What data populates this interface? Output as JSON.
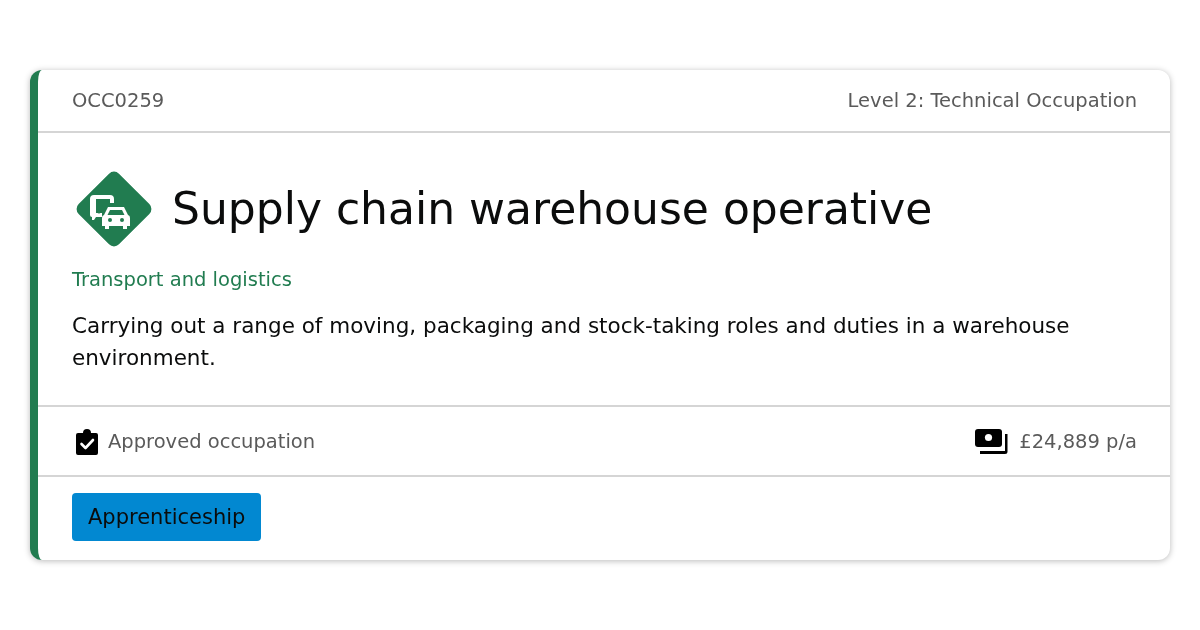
{
  "card": {
    "code": "OCC0259",
    "level": "Level 2: Technical Occupation",
    "title": "Supply chain warehouse operative",
    "category": "Transport and logistics",
    "description": "Carrying out a range of moving, packaging and stock-taking roles and duties in a warehouse environment.",
    "status": "Approved occupation",
    "salary": "£24,889 p/a",
    "tags": [
      "Apprenticeship"
    ]
  }
}
